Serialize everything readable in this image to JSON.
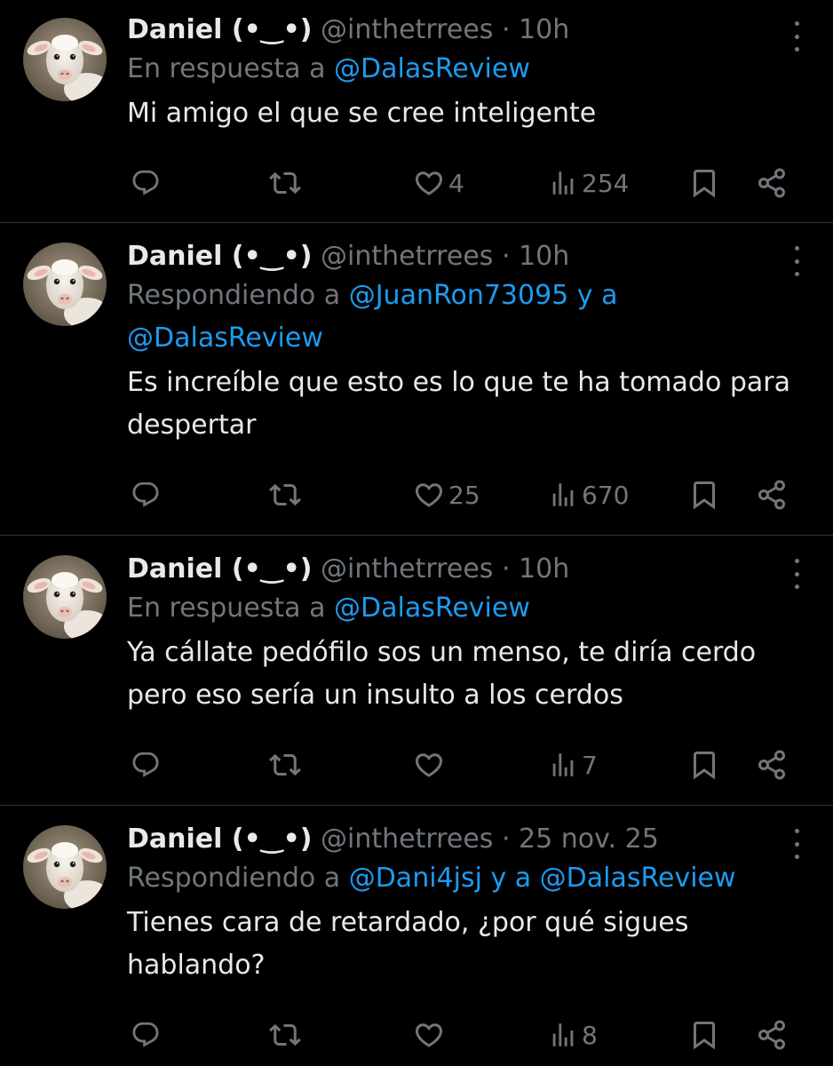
{
  "colors": {
    "background": "#000000",
    "text_primary": "#e7e9ea",
    "text_secondary": "#71767b",
    "accent_link": "#1d9bf0",
    "divider": "#2f3336"
  },
  "tweets": [
    {
      "display_name": "Daniel (•‿•)",
      "handle": "@inthetrrees",
      "separator": "·",
      "time": "10h",
      "reply_prefix": "En respuesta a ",
      "reply_mention_1": "@DalasReview",
      "reply_joiner": "",
      "reply_mention_2": "",
      "text": "Mi amigo el que se cree inteligente",
      "like_count": "4",
      "view_count": "254"
    },
    {
      "display_name": "Daniel (•‿•)",
      "handle": "@inthetrrees",
      "separator": "·",
      "time": "10h",
      "reply_prefix": "Respondiendo a ",
      "reply_mention_1": "@JuanRon73095 y a",
      "reply_joiner": " ",
      "reply_mention_2": "@DalasReview",
      "text": "Es increíble que esto es lo que te ha tomado para despertar",
      "like_count": "25",
      "view_count": "670"
    },
    {
      "display_name": "Daniel (•‿•)",
      "handle": "@inthetrrees",
      "separator": "·",
      "time": "10h",
      "reply_prefix": "En respuesta a ",
      "reply_mention_1": "@DalasReview",
      "reply_joiner": "",
      "reply_mention_2": "",
      "text": "Ya cállate pedófilo sos un menso, te diría cerdo pero eso sería un insulto a los cerdos",
      "like_count": "",
      "view_count": "7"
    },
    {
      "display_name": "Daniel (•‿•)",
      "handle": "@inthetrrees",
      "separator": "·",
      "time": "25 nov. 25",
      "reply_prefix": "Respondiendo a ",
      "reply_mention_1": "@Dani4jsj y a @DalasReview",
      "reply_joiner": "",
      "reply_mention_2": "",
      "text": "Tienes cara de retardado, ¿por qué sigues hablando?",
      "like_count": "",
      "view_count": "8"
    }
  ],
  "icons": {
    "avatar": "lamb-avatar",
    "more": "more-options-icon",
    "reply": "reply-icon",
    "retweet": "retweet-icon",
    "like": "heart-icon",
    "views": "views-icon",
    "bookmark": "bookmark-icon",
    "share": "share-icon"
  }
}
